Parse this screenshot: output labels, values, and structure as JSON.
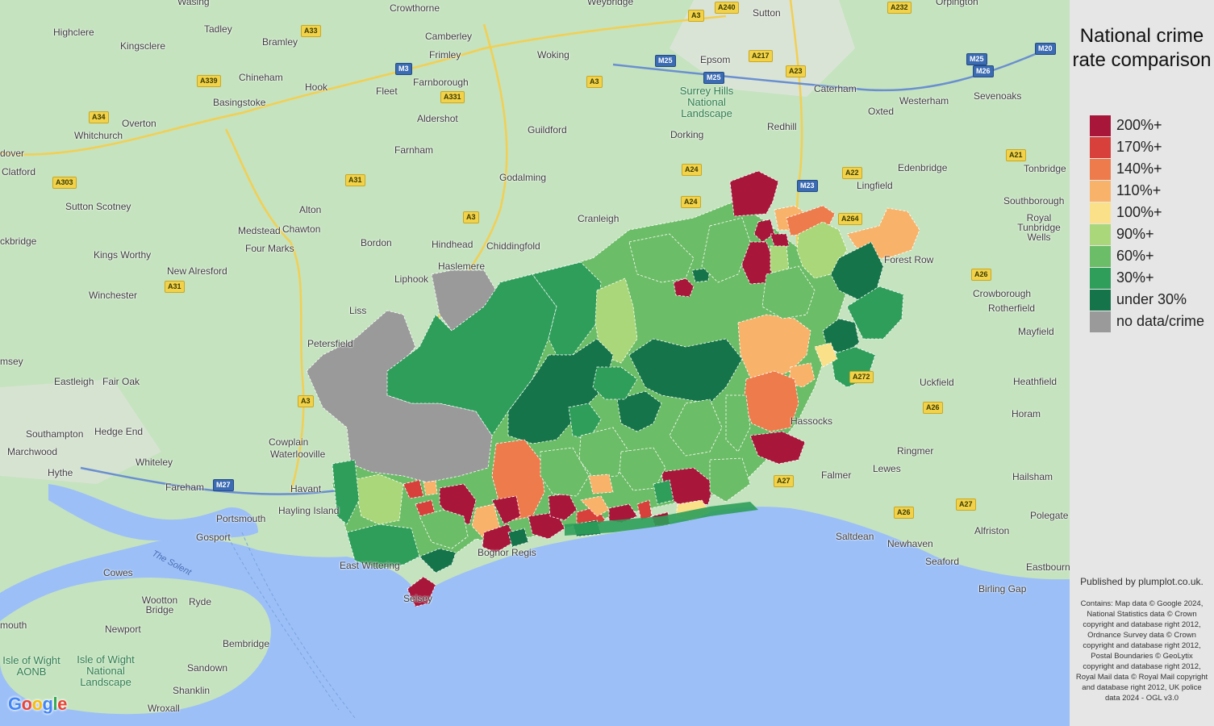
{
  "legend": {
    "title": "National crime rate comparison",
    "items": [
      {
        "label": "200%+",
        "color": "#a8163a"
      },
      {
        "label": "170%+",
        "color": "#d8403c"
      },
      {
        "label": "140%+",
        "color": "#ee7b4c"
      },
      {
        "label": "110%+",
        "color": "#f8b26a"
      },
      {
        "label": "100%+",
        "color": "#fbe08a"
      },
      {
        "label": "90%+",
        "color": "#aad779"
      },
      {
        "label": "60%+",
        "color": "#6cbd67"
      },
      {
        "label": "30%+",
        "color": "#2e9e5a"
      },
      {
        "label": "under 30%",
        "color": "#16744a"
      },
      {
        "label": "no data/crime",
        "color": "#9a9a9a"
      }
    ]
  },
  "attribution": {
    "published": "Published by plumplot.co.uk.",
    "contains": "Contains: Map data © Google 2024, National Statistics data © Crown copyright and database right 2012, Ordnance Survey data © Crown copyright and database right 2012, Postal Boundaries © GeoLytix copyright and database right 2012, Royal Mail data © Royal Mail copyright and database right 2012, UK police data 2024 - OGL v3.0",
    "logo": "Google"
  },
  "map": {
    "places": [
      "Wasing",
      "Crowthorne",
      "Weybridge",
      "Sutton",
      "Orpington",
      "Highclere",
      "Tadley",
      "Bramley",
      "Camberley",
      "Frimley",
      "Woking",
      "Epsom",
      "Kingsclere",
      "Chineham",
      "Hook",
      "Fleet",
      "Farnborough",
      "Basingstoke",
      "Caterham",
      "Westerham",
      "Sevenoaks",
      "Overton",
      "Aldershot",
      "Guildford",
      "Dorking",
      "Redhill",
      "Oxted",
      "Whitchurch",
      "Farnham",
      "Edenbridge",
      "dover",
      "Clatford",
      "Godalming",
      "Tonbridge",
      "Sutton Scotney",
      "Alton",
      "Lingfield",
      "Southborough",
      "Cranleigh",
      "Royal Tunbridge Wells",
      "Medstead",
      "Chawton",
      "Four Marks",
      "Bordon",
      "Hindhead",
      "Chiddingfold",
      "ckbridge",
      "Kings Worthy",
      "Haslemere",
      "New Alresford",
      "Liphook",
      "Forest Row",
      "Winchester",
      "Crowborough",
      "Rotherfield",
      "Liss",
      "Mayfield",
      "Petersfield",
      "msey",
      "Uckfield",
      "Heathfield",
      "Eastleigh",
      "Fair Oak",
      "Horam",
      "Southampton",
      "Hedge End",
      "Cowplain",
      "Waterlooville",
      "Hassocks",
      "Ringmer",
      "Marchwood",
      "Hythe",
      "Whiteley",
      "Lewes",
      "Hailsham",
      "Fareham",
      "Havant",
      "Falmer",
      "Hayling Island",
      "Portsmouth",
      "Polegate",
      "Gosport",
      "Saltdean",
      "Newhaven",
      "Alfriston",
      "Seaford",
      "East Wittering",
      "Cowes",
      "Eastbourne",
      "Birling Gap",
      "Wootton Bridge",
      "Ryde",
      "Newport",
      "Bembridge",
      "Sandown",
      "mouth",
      "Shanklin",
      "Wroxall",
      "Bognor Regis",
      "Selsey"
    ],
    "motorways": [
      "M3",
      "M25",
      "M25",
      "M20",
      "M23",
      "M25",
      "M26",
      "M27"
    ],
    "a_roads": [
      "A33",
      "A3",
      "A240",
      "A232",
      "A339",
      "A217",
      "A23",
      "A331",
      "A34",
      "A22",
      "A21",
      "A24",
      "A303",
      "A31",
      "A24",
      "A264",
      "A3",
      "A31",
      "A3",
      "A26",
      "A272",
      "A26",
      "A3",
      "A27",
      "A26",
      "A27"
    ],
    "landscapes": [
      "Surrey Hills National Landscape",
      "Isle of Wight AONB",
      "Isle of Wight National Landscape"
    ],
    "water": "The Solent"
  }
}
